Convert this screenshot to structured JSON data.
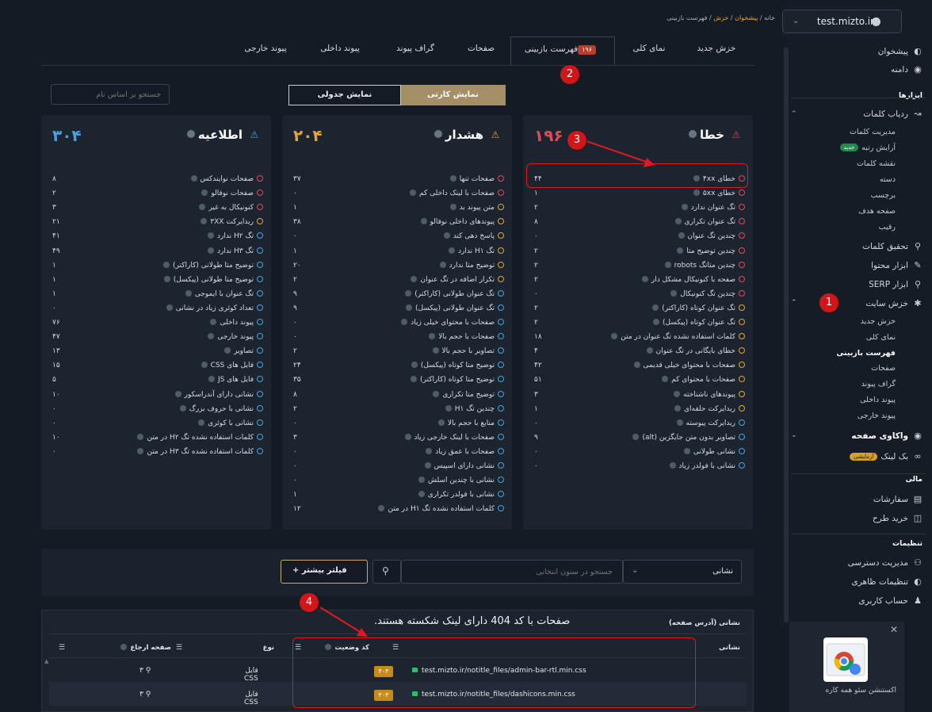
{
  "site": {
    "domain": "test.mizto.ir"
  },
  "breadcrumb": {
    "items": [
      "خانه",
      "پیشخوان",
      "خزش",
      "فهرست بازبینی"
    ],
    "sep": "/"
  },
  "tabs": [
    {
      "label": "خزش جدید"
    },
    {
      "label": "نمای کلی"
    },
    {
      "label": "فهرست بازبینی",
      "badge": "۱۹۶",
      "active": true
    },
    {
      "label": "صفحات"
    },
    {
      "label": "گراف پیوند"
    },
    {
      "label": "پیوند داخلی"
    },
    {
      "label": "پیوند خارجی"
    }
  ],
  "annotations": [
    "1",
    "2",
    "3",
    "4"
  ],
  "search_name": {
    "placeholder": "جستجو بر اساس نام"
  },
  "view_toggle": {
    "card": "نمایش کارتی",
    "table": "نمایش جدولی",
    "active": "card"
  },
  "cards": {
    "errors": {
      "title": "خطا",
      "count": "۱۹۶",
      "color": "#e04a55",
      "rows": [
        {
          "label": "خطای ۴xx",
          "value": "۴۴",
          "dot": "#e04a55"
        },
        {
          "label": "خطای ۵xx",
          "value": "۱",
          "dot": "#e04a55"
        },
        {
          "label": "تگ عنوان ندارد",
          "value": "۲",
          "dot": "#e04a55"
        },
        {
          "label": "تگ عنوان تکراری",
          "value": "۸",
          "dot": "#e04a55"
        },
        {
          "label": "چندین تگ عنوان",
          "value": "۰",
          "dot": "#e04a55"
        },
        {
          "label": "چندین توضیح متا",
          "value": "۲",
          "dot": "#e04a55"
        },
        {
          "label": "چندین متاتگ robots",
          "value": "۲",
          "dot": "#e04a55"
        },
        {
          "label": "صفحه با کنونیکال مشکل دار",
          "value": "۲",
          "dot": "#e04a55"
        },
        {
          "label": "چندین تگ کنونیکال",
          "value": "۰",
          "dot": "#e04a55"
        },
        {
          "label": "تگ عنوان کوتاه (کاراکتر)",
          "value": "۲",
          "dot": "#e2a637"
        },
        {
          "label": "تگ عنوان کوتاه (پیکسل)",
          "value": "۲",
          "dot": "#e2a637"
        },
        {
          "label": "کلمات استفاده نشده تگ عنوان در متن",
          "value": "۱۸",
          "dot": "#e2a637"
        },
        {
          "label": "خطای بایگانی در تگ عنوان",
          "value": "۴",
          "dot": "#e2a637"
        },
        {
          "label": "صفحات با محتوای خیلی قدیمی",
          "value": "۴۲",
          "dot": "#e2a637"
        },
        {
          "label": "صفحات با محتوای کم",
          "value": "۵۱",
          "dot": "#e2a637"
        },
        {
          "label": "پیوندهای ناشناخته",
          "value": "۳",
          "dot": "#e2a637"
        },
        {
          "label": "ریدایرکت حلقه‌ای",
          "value": "۱",
          "dot": "#e2a637"
        },
        {
          "label": "ریدایرکت پیوسته",
          "value": "۰",
          "dot": "#4aa3e0"
        },
        {
          "label": "تصاویر بدون متن جایگزین (alt)",
          "value": "۹",
          "dot": "#4aa3e0"
        },
        {
          "label": "نشانی طولانی",
          "value": "۰",
          "dot": "#4aa3e0"
        },
        {
          "label": "نشانی با فولدر زیاد",
          "value": "۰",
          "dot": "#4aa3e0"
        }
      ]
    },
    "warnings": {
      "title": "هشدار",
      "count": "۲۰۴",
      "color": "#e2a637",
      "rows": [
        {
          "label": "صفحات تنها",
          "value": "۳۷",
          "dot": "#e04a55"
        },
        {
          "label": "صفحات با لینک داخلی کم",
          "value": "۰",
          "dot": "#e04a55"
        },
        {
          "label": "متن پیوند بد",
          "value": "۱",
          "dot": "#e2a637"
        },
        {
          "label": "پیوندهای داخلی نوفالو",
          "value": "۳۸",
          "dot": "#e2a637"
        },
        {
          "label": "پاسخ دهی کند",
          "value": "۰",
          "dot": "#e2a637"
        },
        {
          "label": "تگ H۱ ندارد",
          "value": "۱",
          "dot": "#e2a637"
        },
        {
          "label": "توضیح متا ندارد",
          "value": "۲۰",
          "dot": "#e2a637"
        },
        {
          "label": "تکرار اضافه در تگ عنوان",
          "value": "۲",
          "dot": "#e2a637"
        },
        {
          "label": "تگ عنوان طولانی (کاراکتر)",
          "value": "۹",
          "dot": "#4aa3e0"
        },
        {
          "label": "تگ عنوان طولانی (پیکسل)",
          "value": "۹",
          "dot": "#4aa3e0"
        },
        {
          "label": "صفحات با محتوای خیلی زیاد",
          "value": "۰",
          "dot": "#4aa3e0"
        },
        {
          "label": "صفحات با حجم بالا",
          "value": "۰",
          "dot": "#4aa3e0"
        },
        {
          "label": "تصاویر با حجم بالا",
          "value": "۲",
          "dot": "#4aa3e0"
        },
        {
          "label": "توضیح متا کوتاه (پیکسل)",
          "value": "۲۴",
          "dot": "#4aa3e0"
        },
        {
          "label": "توضیح متا کوتاه (کاراکتر)",
          "value": "۳۵",
          "dot": "#4aa3e0"
        },
        {
          "label": "توضیح متا تکراری",
          "value": "۸",
          "dot": "#4aa3e0"
        },
        {
          "label": "چندین تگ H۱",
          "value": "۲",
          "dot": "#4aa3e0"
        },
        {
          "label": "منابع با حجم بالا",
          "value": "۰",
          "dot": "#4aa3e0"
        },
        {
          "label": "صفحات با لینک خارجی زیاد",
          "value": "۳",
          "dot": "#4aa3e0"
        },
        {
          "label": "صفحات با عمق زیاد",
          "value": "۰",
          "dot": "#4aa3e0"
        },
        {
          "label": "نشانی دارای اسپیس",
          "value": "۰",
          "dot": "#4aa3e0"
        },
        {
          "label": "نشانی با چندین اسلش",
          "value": "۰",
          "dot": "#4aa3e0"
        },
        {
          "label": "نشانی با فولدر تکراری",
          "value": "۱",
          "dot": "#4aa3e0"
        },
        {
          "label": "کلمات استفاده نشده تگ H۱ در متن",
          "value": "۱۲",
          "dot": "#4aa3e0"
        }
      ]
    },
    "notices": {
      "title": "اطلاعیه",
      "count": "۳۰۴",
      "color": "#4aa3e0",
      "rows": [
        {
          "label": "صفحات نوایندکس",
          "value": "۸",
          "dot": "#e04a55"
        },
        {
          "label": "صفحات نوفالو",
          "value": "۲",
          "dot": "#e04a55"
        },
        {
          "label": "کنونیکال به غیر",
          "value": "۳",
          "dot": "#e04a55"
        },
        {
          "label": "ریدایرکت ۳XX",
          "value": "۲۱",
          "dot": "#e2a637"
        },
        {
          "label": "تگ H۲ ندارد",
          "value": "۴۱",
          "dot": "#4aa3e0"
        },
        {
          "label": "تگ H۳ ندارد",
          "value": "۴۹",
          "dot": "#4aa3e0"
        },
        {
          "label": "توضیح متا طولانی (کاراکتر)",
          "value": "۱",
          "dot": "#4aa3e0"
        },
        {
          "label": "توضیح متا طولانی (پیکسل)",
          "value": "۱",
          "dot": "#4aa3e0"
        },
        {
          "label": "تگ عنوان با ایموجی",
          "value": "۱",
          "dot": "#4aa3e0"
        },
        {
          "label": "تعداد کوئری زیاد در نشانی",
          "value": "۰",
          "dot": "#4aa3e0"
        },
        {
          "label": "پیوند داخلی",
          "value": "۷۶",
          "dot": "#4aa3e0"
        },
        {
          "label": "پیوند خارجی",
          "value": "۴۷",
          "dot": "#4aa3e0"
        },
        {
          "label": "تصاویر",
          "value": "۱۳",
          "dot": "#4aa3e0"
        },
        {
          "label": "فایل های CSS",
          "value": "۱۵",
          "dot": "#4aa3e0"
        },
        {
          "label": "فایل های JS",
          "value": "۵",
          "dot": "#4aa3e0"
        },
        {
          "label": "نشانی دارای آندراسکور",
          "value": "۱۰",
          "dot": "#4aa3e0"
        },
        {
          "label": "نشانی با حروف بزرگ",
          "value": "۰",
          "dot": "#4aa3e0"
        },
        {
          "label": "نشانی با کوئری",
          "value": "۰",
          "dot": "#4aa3e0"
        },
        {
          "label": "کلمات استفاده نشده تگ H۲ در متن",
          "value": "۱۰",
          "dot": "#4aa3e0"
        },
        {
          "label": "کلمات استفاده نشده تگ H۳ در متن",
          "value": "۰",
          "dot": "#4aa3e0"
        }
      ]
    }
  },
  "filter": {
    "column_select": "نشانی",
    "search_placeholder": "جستجو در ستون انتخابی",
    "more_filters": "فیلتر بیشتر"
  },
  "table": {
    "caption": "نشانی (آدرس صفحه)",
    "annotation_text": "صفحات با کد 404 دارای لینک شکسته هستند.",
    "headers": [
      "نشانی",
      "کد وضعیت",
      "نوع",
      "صفحه ارجاع"
    ],
    "rows": [
      {
        "url": "test.mizto.ir/notitle_files/admin-bar-rtl.min.css",
        "status": "۴۰۴",
        "type": "فایل CSS",
        "ref": "۳"
      },
      {
        "url": "test.mizto.ir/notitle_files/dashicons.min.css",
        "status": "۴۰۴",
        "type": "فایل CSS",
        "ref": "۳"
      }
    ]
  },
  "sidebar": {
    "dashboard": "پیشخوان",
    "domain": "دامنه",
    "tools_head": "ابزارها",
    "rank_tracking": "ردیاب کلمات",
    "rank_sub": [
      "مدیریت کلمات",
      "آرایش رتبه",
      "نقشه کلمات",
      "دسته",
      "برچسب",
      "صفحه هدف",
      "رقیب"
    ],
    "new_badge": "جدید",
    "keyword_research": "تحقیق کلمات",
    "content_tool": "ابزار محتوا",
    "serp_tool": "ابزار SERP",
    "crawl": "خزش سایت",
    "crawl_sub": [
      "خزش جدید",
      "نمای کلی",
      "فهرست بازبینی",
      "صفحات",
      "گراف پیوند",
      "پیوند داخلی",
      "پیوند خارجی"
    ],
    "page_analysis": "واکاوی صفحه",
    "backlink": "بک لینک",
    "trial_badge": "آزمایشی",
    "finance_head": "مالی",
    "orders": "سفارشات",
    "buy_plan": "خرید طرح",
    "settings_head": "تنظیمات",
    "access": "مدیریت دسترسی",
    "appearance": "تنظیمات ظاهری",
    "account": "حساب کاربری",
    "ext_text": "اکستنشن سئو همه کاره"
  }
}
